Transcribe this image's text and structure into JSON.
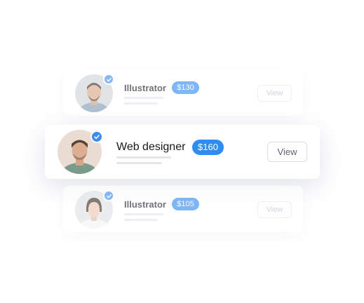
{
  "cards": [
    {
      "title": "Illustrator",
      "price": "$130",
      "button": "View"
    },
    {
      "title": "Web designer",
      "price": "$160",
      "button": "View"
    },
    {
      "title": "Illustrator",
      "price": "$105",
      "button": "View"
    }
  ],
  "colors": {
    "accent": "#2f8cf3",
    "check": "#3d8ef0",
    "text": "#1b1d22"
  },
  "icons": [
    "check-icon"
  ]
}
